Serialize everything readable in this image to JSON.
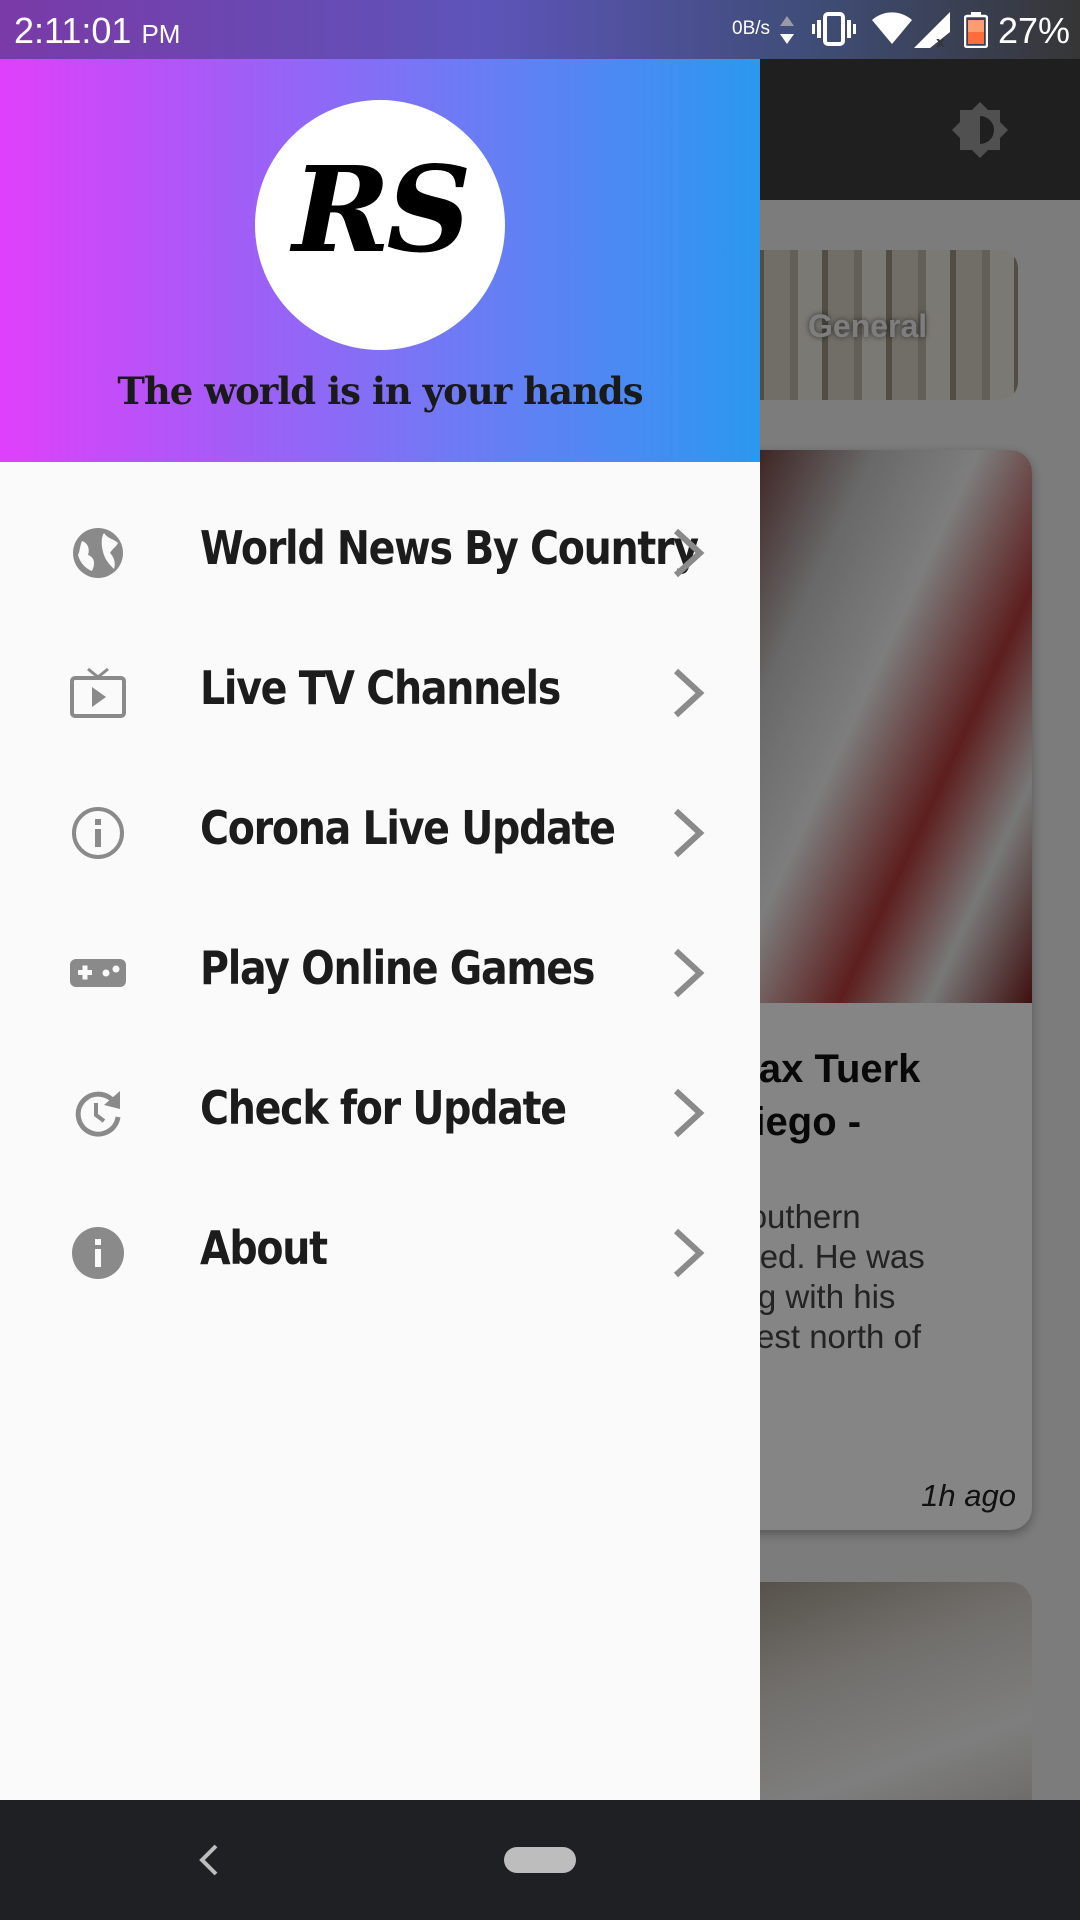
{
  "status_bar": {
    "time": "2:11:01",
    "ampm": "PM",
    "net_speed": "0B/s",
    "battery_percent": "27%"
  },
  "background": {
    "category_label": "General",
    "card_title": "n Max Tuerk\nn Diego -",
    "card_description": "at Southern\nas died. He was\nhiking with his\nl Forest north of",
    "card_time": "1h ago"
  },
  "drawer": {
    "logo_text": "RS",
    "tagline": "The world is in your hands",
    "items": [
      {
        "label": "World News By Country",
        "icon": "globe-icon"
      },
      {
        "label": "Live TV Channels",
        "icon": "tv-icon"
      },
      {
        "label": "Corona Live Update",
        "icon": "info-outline-icon"
      },
      {
        "label": "Play Online Games",
        "icon": "gamepad-icon"
      },
      {
        "label": "Check for Update",
        "icon": "update-icon"
      },
      {
        "label": "About",
        "icon": "info-icon"
      }
    ]
  },
  "colors": {
    "header_gradient_start": "#e040fb",
    "header_gradient_end": "#2b98f0",
    "drawer_background": "#fafafa",
    "icon_gray": "#8a8a8a"
  }
}
